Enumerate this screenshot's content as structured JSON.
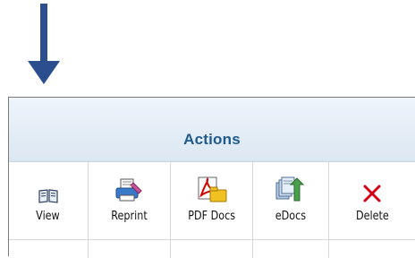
{
  "indicator": {
    "icon": "arrow-down-icon",
    "color": "#2a4e8e"
  },
  "actions": {
    "title": "Actions",
    "items": [
      {
        "id": "view",
        "label": "View",
        "icon": "book-icon"
      },
      {
        "id": "reprint",
        "label": "Reprint",
        "icon": "reprint-icon"
      },
      {
        "id": "pdf",
        "label": "PDF Docs",
        "icon": "pdf-icon"
      },
      {
        "id": "edocs",
        "label": "eDocs",
        "icon": "edocs-icon"
      },
      {
        "id": "delete",
        "label": "Delete",
        "icon": "close-icon"
      }
    ]
  },
  "colors": {
    "header_text": "#1f5a8c",
    "delete_red": "#d4001a"
  }
}
